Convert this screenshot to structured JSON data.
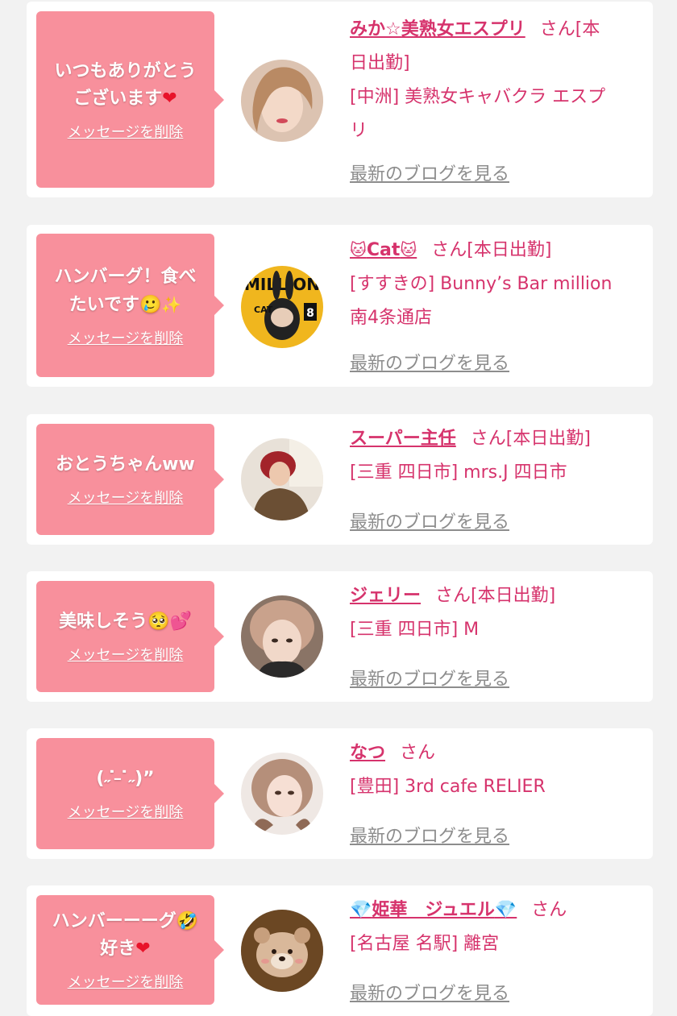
{
  "common": {
    "delete_label": "メッセージを削除",
    "blog_label": "最新のブログを見る",
    "suffix": "さん[本日出勤]",
    "suffix_plain": "さん"
  },
  "items": [
    {
      "message_line1": "いつもありがとう",
      "message_line2": "ございます",
      "name": "みか☆美熟女エスプリ",
      "status": "さん[本",
      "status_wrap": "日出勤]",
      "shop_line1": "[中洲] 美熟女キャバクラ エスプ",
      "shop_line2": "リ"
    },
    {
      "message_line1": "ハンバーグ！食べ",
      "message_line2": "たいです",
      "name": "Cat",
      "shop_line1": "[すすきの] Bunny’s Bar million",
      "shop_line2": "南4条通店",
      "avatar_text_top": "MILLION",
      "avatar_text_cat": "CAT",
      "avatar_text_num": "8"
    },
    {
      "message_line1": "おとうちゃんww",
      "name": "スーパー主任",
      "shop_line1": "[三重 四日市] mrs.J 四日市"
    },
    {
      "message_line1": "美味しそう",
      "name": "ジェリー",
      "shop_line1": "[三重 四日市] M"
    },
    {
      "message_line1": "(˶ ̇ ̵ ̇˶)”",
      "name": "なつ",
      "shop_line1": "[豊田] 3rd cafe RELIER"
    },
    {
      "message_line1": "ハンバーーーグ",
      "message_line2": "好き",
      "name": "姫華　ジュエル",
      "shop_line1": "[名古屋 名駅] 離宮"
    }
  ],
  "colors": {
    "bubble": "#f8909c",
    "accent": "#d6336c",
    "link_gray": "#8d8d8d",
    "background": "#f2f2f2"
  }
}
